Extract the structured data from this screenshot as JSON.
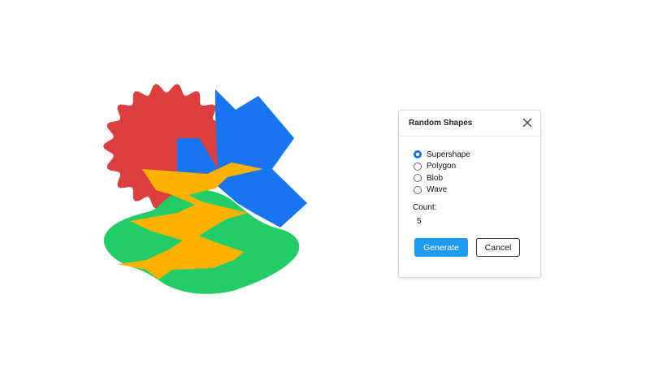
{
  "dialog": {
    "title": "Random Shapes",
    "close_icon": "close-icon",
    "shape_options": [
      {
        "label": "Supershape",
        "selected": true
      },
      {
        "label": "Polygon",
        "selected": false
      },
      {
        "label": "Blob",
        "selected": false
      },
      {
        "label": "Wave",
        "selected": false
      }
    ],
    "count_label": "Count:",
    "count_value": "5",
    "generate_label": "Generate",
    "cancel_label": "Cancel"
  },
  "canvas": {
    "shapes": [
      {
        "kind": "supershape",
        "color": "#dc3f3f"
      },
      {
        "kind": "polygon",
        "color": "#1775f0"
      },
      {
        "kind": "blob",
        "color": "#22cc66"
      },
      {
        "kind": "wave",
        "color": "#ffb300"
      }
    ]
  }
}
